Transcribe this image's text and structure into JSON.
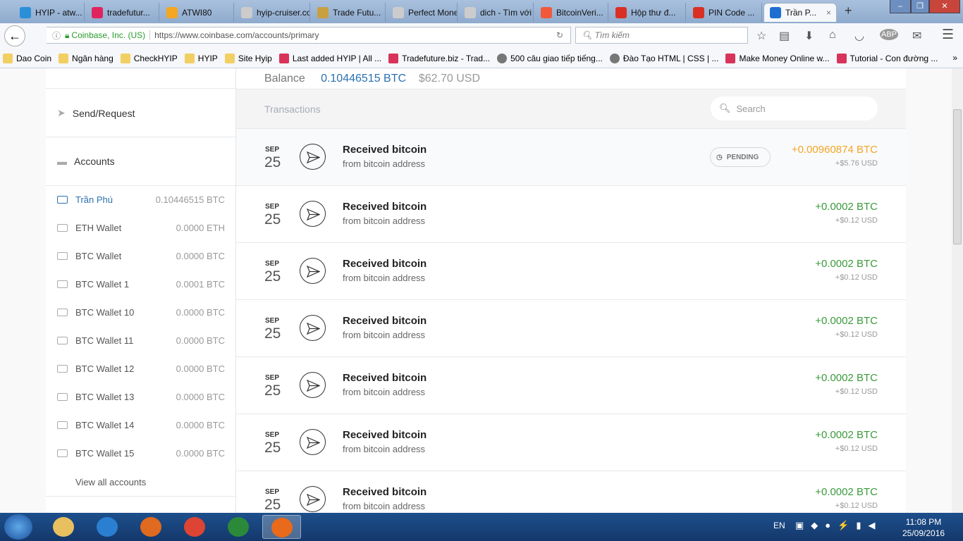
{
  "browser": {
    "tabs": [
      {
        "title": "HYIP - atw...",
        "color": "#2a8fd8"
      },
      {
        "title": "tradefutur...",
        "color": "#e0245e"
      },
      {
        "title": "ATWI80",
        "color": "#f5a623"
      },
      {
        "title": "hyip-cruiser.co...",
        "color": "#ccc"
      },
      {
        "title": "Trade Futu...",
        "color": "#c8a040"
      },
      {
        "title": "Perfect Money...",
        "color": "#ccc"
      },
      {
        "title": "dich - Tìm với ...",
        "color": "#ccc"
      },
      {
        "title": "BitcoinVeri...",
        "color": "#f05a3a"
      },
      {
        "title": "Hộp thư đ...",
        "color": "#d93025"
      },
      {
        "title": "PIN Code ...",
        "color": "#d93025"
      },
      {
        "title": "Trần P...",
        "color": "#1f6fd0"
      }
    ],
    "new_tab": "+",
    "site_identity": "Coinbase, Inc. (US)",
    "url": "https://www.coinbase.com/accounts/primary",
    "search_placeholder": "Tìm kiếm",
    "bookmarks": [
      {
        "label": "Dao Coin",
        "icon": "folder"
      },
      {
        "label": "Ngân hàng",
        "icon": "folder"
      },
      {
        "label": "CheckHYIP",
        "icon": "folder"
      },
      {
        "label": "HYIP",
        "icon": "folder"
      },
      {
        "label": "Site Hyip",
        "icon": "folder"
      },
      {
        "label": "Last added HYIP | All ...",
        "icon": "site"
      },
      {
        "label": "Tradefuture.biz - Trad...",
        "icon": "site"
      },
      {
        "label": "500 câu giao tiếp tiếng...",
        "icon": "globe"
      },
      {
        "label": "Đào Tạo HTML | CSS | ...",
        "icon": "globe"
      },
      {
        "label": "Make Money Online w...",
        "icon": "site"
      },
      {
        "label": "Tutorial - Con đường ...",
        "icon": "site"
      }
    ],
    "bookmarks_overflow": "»"
  },
  "sidebar": {
    "send_request": "Send/Request",
    "accounts": "Accounts",
    "wallets": [
      {
        "name": "Trần Phú",
        "balance": "0.10446515 BTC",
        "selected": true
      },
      {
        "name": "ETH Wallet",
        "balance": "0.0000 ETH"
      },
      {
        "name": "BTC Wallet",
        "balance": "0.0000 BTC"
      },
      {
        "name": "BTC Wallet 1",
        "balance": "0.0001 BTC"
      },
      {
        "name": "BTC Wallet 10",
        "balance": "0.0000 BTC"
      },
      {
        "name": "BTC Wallet 11",
        "balance": "0.0000 BTC"
      },
      {
        "name": "BTC Wallet 12",
        "balance": "0.0000 BTC"
      },
      {
        "name": "BTC Wallet 13",
        "balance": "0.0000 BTC"
      },
      {
        "name": "BTC Wallet 14",
        "balance": "0.0000 BTC"
      },
      {
        "name": "BTC Wallet 15",
        "balance": "0.0000 BTC"
      }
    ],
    "view_all": "View all accounts"
  },
  "main": {
    "balance_label": "Balance",
    "balance_btc": "0.10446515 BTC",
    "balance_usd": "$62.70 USD",
    "transactions_title": "Transactions",
    "search_placeholder": "Search",
    "transactions": [
      {
        "month": "SEP",
        "day": "25",
        "title": "Received bitcoin",
        "from": "from bitcoin address",
        "amount": "+0.00960874 BTC",
        "usd": "+$5.76 USD",
        "status": "PENDING",
        "color": "#f5a623"
      },
      {
        "month": "SEP",
        "day": "25",
        "title": "Received bitcoin",
        "from": "from bitcoin address",
        "amount": "+0.0002 BTC",
        "usd": "+$0.12 USD",
        "color": "#3a9a3a"
      },
      {
        "month": "SEP",
        "day": "25",
        "title": "Received bitcoin",
        "from": "from bitcoin address",
        "amount": "+0.0002 BTC",
        "usd": "+$0.12 USD",
        "color": "#3a9a3a"
      },
      {
        "month": "SEP",
        "day": "25",
        "title": "Received bitcoin",
        "from": "from bitcoin address",
        "amount": "+0.0002 BTC",
        "usd": "+$0.12 USD",
        "color": "#3a9a3a"
      },
      {
        "month": "SEP",
        "day": "25",
        "title": "Received bitcoin",
        "from": "from bitcoin address",
        "amount": "+0.0002 BTC",
        "usd": "+$0.12 USD",
        "color": "#3a9a3a"
      },
      {
        "month": "SEP",
        "day": "25",
        "title": "Received bitcoin",
        "from": "from bitcoin address",
        "amount": "+0.0002 BTC",
        "usd": "+$0.12 USD",
        "color": "#3a9a3a"
      },
      {
        "month": "SEP",
        "day": "25",
        "title": "Received bitcoin",
        "from": "from bitcoin address",
        "amount": "+0.0002 BTC",
        "usd": "+$0.12 USD",
        "color": "#3a9a3a"
      }
    ]
  },
  "taskbar": {
    "apps": [
      "Windows Explorer",
      "Internet Explorer",
      "Media Player",
      "Chrome",
      "Excel",
      "Firefox"
    ],
    "language": "EN",
    "time": "11:08 PM",
    "date": "25/09/2016"
  }
}
